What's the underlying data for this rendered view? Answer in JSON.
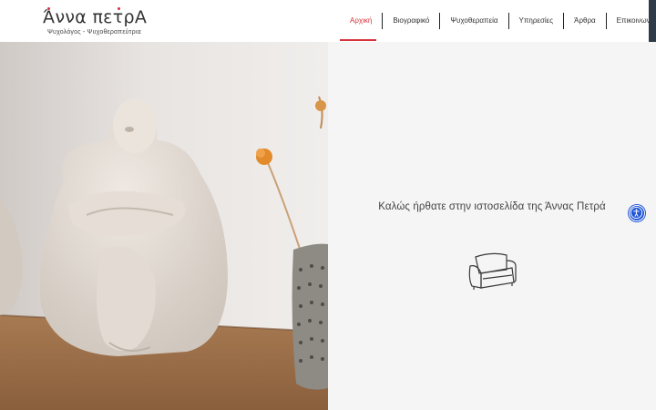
{
  "site": {
    "title": "Άννα πετρΑ",
    "subtitle": "Ψυχολόγος - Ψυχοθεραπεύτρια"
  },
  "nav": {
    "items": [
      {
        "label": "Αρχική",
        "active": true
      },
      {
        "label": "Βιογραφικό",
        "active": false
      },
      {
        "label": "Ψυχοθεραπεία",
        "active": false
      },
      {
        "label": "Υπηρεσίες",
        "active": false
      },
      {
        "label": "Άρθρα",
        "active": false
      },
      {
        "label": "Επικοινωνία",
        "active": false
      }
    ]
  },
  "hero": {
    "welcome_text": "Καλώς ήρθατε στην ιστοσελίδα της Άννας Πετρά",
    "image_icon": "sculpture-photo",
    "decor_icon": "armchair-icon"
  },
  "accessibility": {
    "icon": "accessibility-icon"
  },
  "colors": {
    "accent": "#d6323a",
    "accessibility": "#2156d6",
    "background": "#f5f5f5"
  }
}
